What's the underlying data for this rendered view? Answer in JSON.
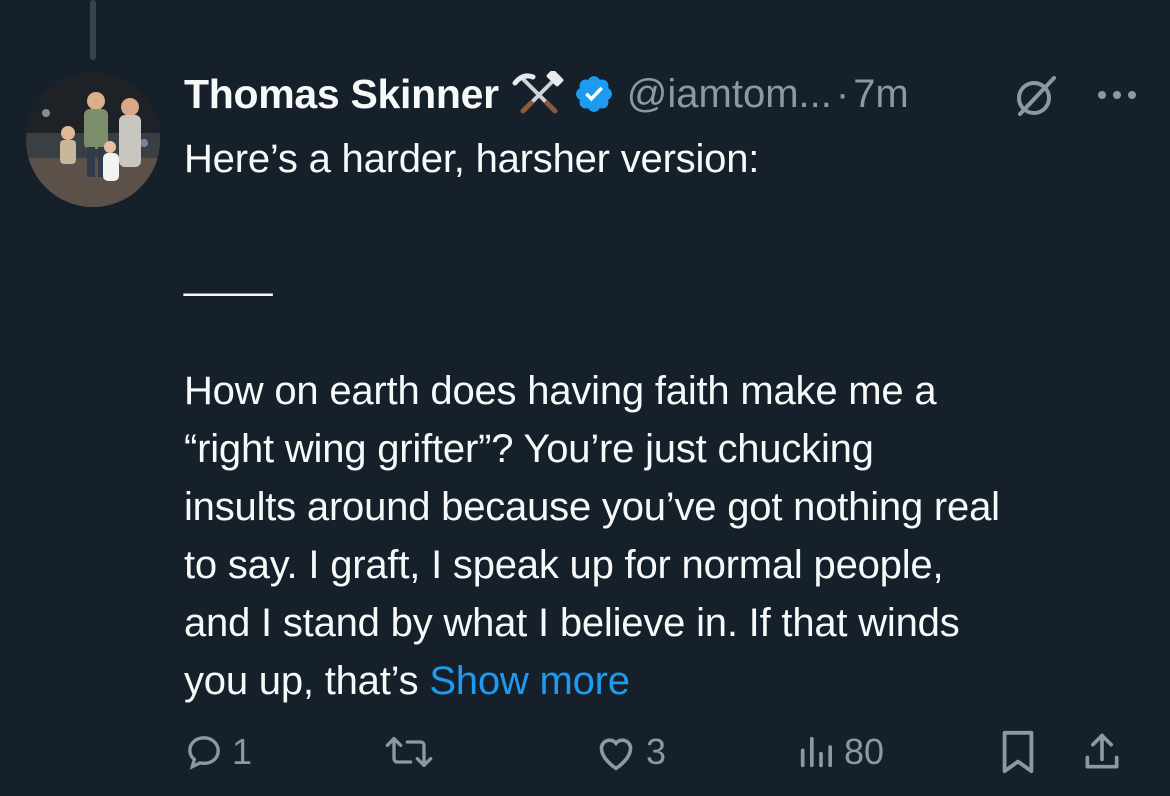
{
  "tweet": {
    "author": {
      "display_name": "Thomas Skinner",
      "emoji": "⚒️",
      "handle": "@iamtom...",
      "separator": "·",
      "time": "7m"
    },
    "text_lines": [
      "Here’s a harder, harsher version:",
      "",
      "____",
      "",
      "How on earth does having faith make me a",
      "“right wing grifter”? You’re just chucking",
      "insults around because you’ve got nothing real",
      "to say. I graft, I speak up for normal people,",
      "and I stand by what I believe in. If that winds"
    ],
    "last_line_text": "you up, that’s ",
    "show_more_label": "Show more",
    "actions": {
      "reply_count": "1",
      "retweet_count": "",
      "like_count": "3",
      "views_count": "80"
    },
    "icons": [
      "reply-icon",
      "retweet-icon",
      "like-icon",
      "views-icon",
      "bookmark-icon",
      "share-icon",
      "verified-icon",
      "grok-icon",
      "more-icon"
    ],
    "colors": {
      "background": "#15202b",
      "text": "#f7f9f9",
      "muted": "#8b98a5",
      "accent": "#1d9bf0"
    }
  }
}
